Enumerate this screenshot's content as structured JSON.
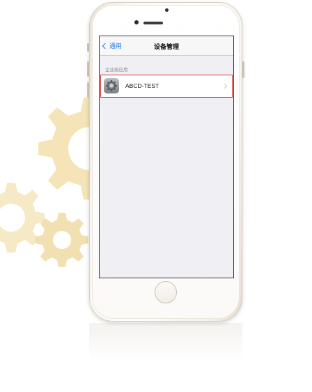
{
  "navbar": {
    "back_label": "通用",
    "title": "设备管理"
  },
  "section": {
    "header": "企业级应用"
  },
  "apps": [
    {
      "name": "ABCD-TEST",
      "icon": "settings-gear-icon",
      "highlighted": true
    }
  ],
  "colors": {
    "accent": "#1e7bf5",
    "highlight_border": "#d8332f",
    "gear_decoration": "#f2dfaa",
    "screen_background": "#efeff4"
  }
}
